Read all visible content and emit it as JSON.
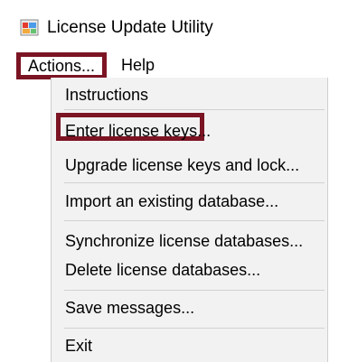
{
  "window": {
    "title": "License Update Utility",
    "icon": "app-window-icon"
  },
  "menu_bar": {
    "items": [
      "Actions...",
      "Help"
    ]
  },
  "dropdown": {
    "items": [
      "Instructions",
      "Enter license keys...",
      "Upgrade license keys and lock...",
      "Import an existing database...",
      "Synchronize license databases...",
      "Delete license databases...",
      "Save messages...",
      "Exit"
    ]
  },
  "colors": {
    "highlight_border": "#7b1423",
    "menu_background": "#f2f2f2",
    "separator": "#d1d1d1"
  }
}
